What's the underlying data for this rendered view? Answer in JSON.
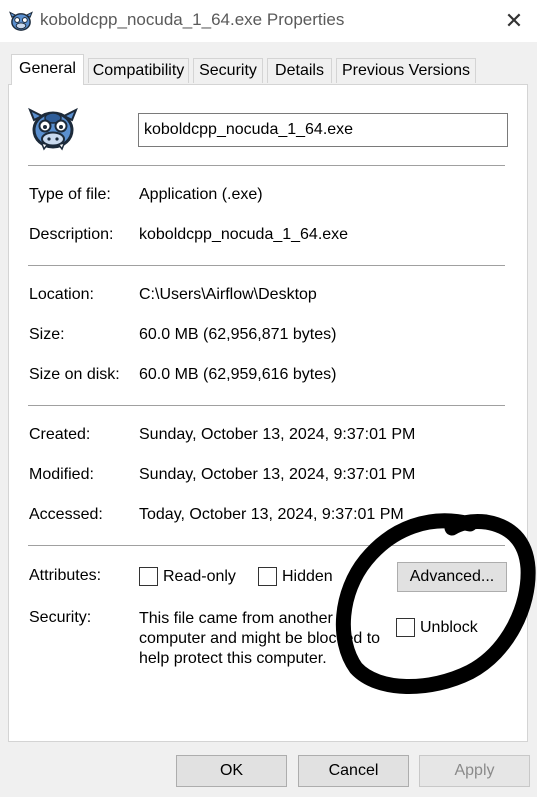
{
  "window": {
    "title": "koboldcpp_nocuda_1_64.exe Properties",
    "close_glyph": "✕"
  },
  "tabs": [
    {
      "label": "General"
    },
    {
      "label": "Compatibility"
    },
    {
      "label": "Security"
    },
    {
      "label": "Details"
    },
    {
      "label": "Previous Versions"
    }
  ],
  "general": {
    "file_name": "koboldcpp_nocuda_1_64.exe",
    "type_label": "Type of file:",
    "type_value": "Application (.exe)",
    "description_label": "Description:",
    "description_value": "koboldcpp_nocuda_1_64.exe",
    "location_label": "Location:",
    "location_value": "C:\\Users\\Airflow\\Desktop",
    "size_label": "Size:",
    "size_value": "60.0 MB (62,956,871 bytes)",
    "size_on_disk_label": "Size on disk:",
    "size_on_disk_value": "60.0 MB (62,959,616 bytes)",
    "created_label": "Created:",
    "created_value": "Sunday, October 13, 2024, 9:37:01 PM",
    "modified_label": "Modified:",
    "modified_value": "Sunday, October 13, 2024, 9:37:01 PM",
    "accessed_label": "Accessed:",
    "accessed_value": "Today, October 13, 2024, 9:37:01 PM",
    "attributes_label": "Attributes:",
    "readonly_label": "Read-only",
    "hidden_label": "Hidden",
    "advanced_button": "Advanced...",
    "security_label": "Security:",
    "security_text": "This file came from another computer and might be blocked to help protect this computer.",
    "unblock_label": "Unblock"
  },
  "footer": {
    "ok": "OK",
    "cancel": "Cancel",
    "apply": "Apply"
  },
  "icons": {
    "app": "kobold-mascot-icon",
    "title": "kobold-mascot-icon"
  },
  "colors": {
    "app_icon_blue": "#4a86c8",
    "scribble": "#000000"
  }
}
